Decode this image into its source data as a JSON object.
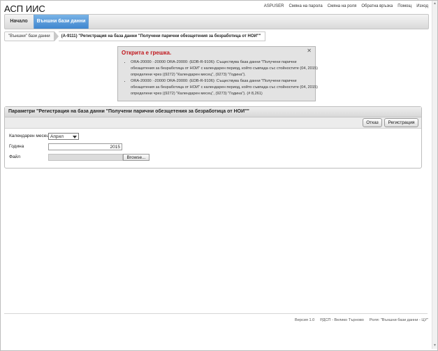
{
  "app": {
    "title": "АСП ИИС"
  },
  "top_links": [
    "ASPUSER",
    "Смяна на парола",
    "Смяна на роля",
    "Обратна връзка",
    "Помощ",
    "Изход"
  ],
  "menu": {
    "home": "Начало",
    "external": "Външни бази данни"
  },
  "breadcrumb": {
    "parent": "\"Външни\" бази данни",
    "current": "(A-9111) \"Регистрация на база данни \"Получени парични обезщетения за безработица от НОИ\"\""
  },
  "error": {
    "title": "Открита е грешка.",
    "close": "✕",
    "messages": [
      "ORA-20000: -20000 ORA-20000: (EDB-R-9106): Съществува база данни \"Получени парични обезщетения за безработица от НОИ\" с календарен период, който съвпада със стойностите (04, 2015) определени чрез ((9272) \"Календарен месец\", (9273) \"Година\").",
      "ORA-20000: -20000 ORA-20000: (EDB-R-9106): Съществува база данни \"Получени парични обезщетения за безработица от НОИ\" с календарен период, който съвпада със стойностите (04, 2015) определени чрез ((9272) \"Календарен месец\", (9273) \"Година\"). (# 8,261)"
    ]
  },
  "panel": {
    "title": "Параметри \"Регистрация на база данни \"Получени парични обезщетения за безработица от НОИ\"\"",
    "cancel": "Отказ",
    "register": "Регистрация",
    "month_label": "Календарен месец",
    "month_value": "Април",
    "year_label": "Година",
    "year_value": "2015",
    "file_label": "Файл",
    "browse": "Browse..."
  },
  "footer": {
    "version": "Версия 1.0",
    "office": "РДСП - Велико Търново",
    "role": "Роля: \"Външни бази данни - ЦУ\""
  }
}
